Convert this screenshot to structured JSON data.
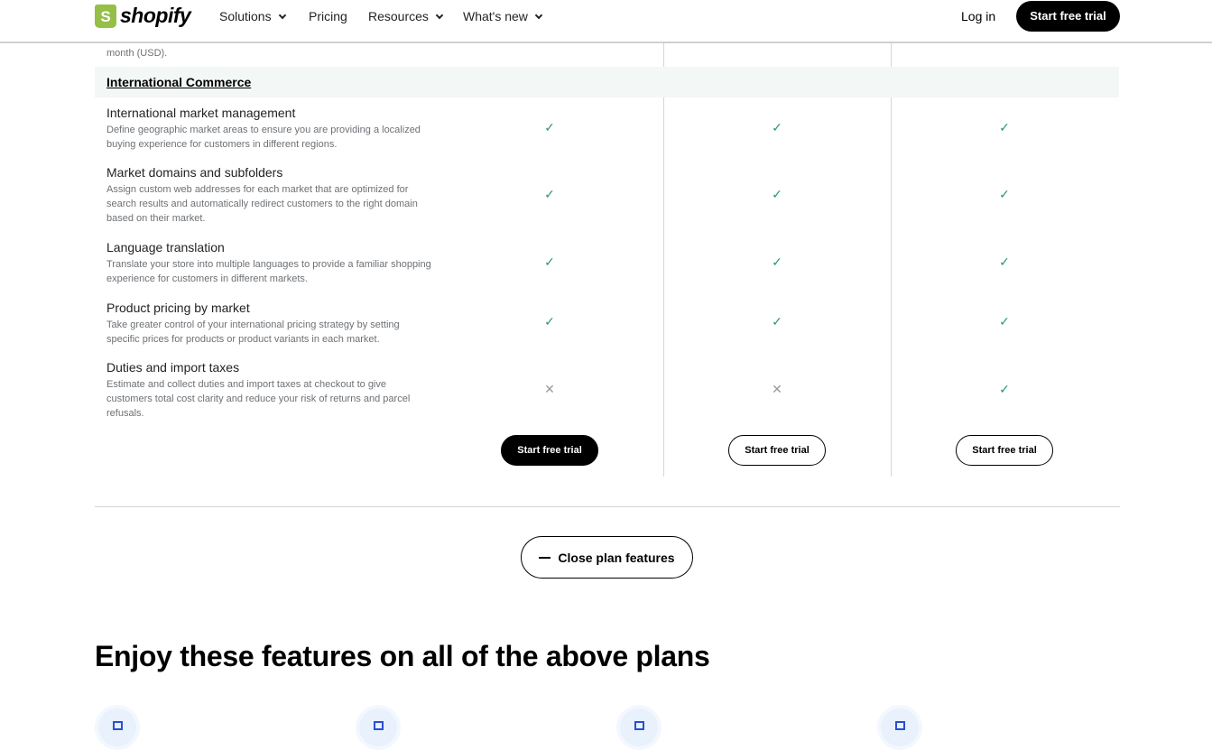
{
  "nav": {
    "logo": "shopify",
    "items": [
      "Solutions",
      "Pricing",
      "Resources",
      "What's new"
    ],
    "login": "Log in",
    "cta": "Start free trial"
  },
  "table": {
    "prev_note": "month (USD).",
    "section": "International Commerce",
    "rows": [
      {
        "title": "International market management",
        "desc": "Define geographic market areas to ensure you are providing a localized buying experience for customers in different regions.",
        "plans": [
          true,
          true,
          true
        ]
      },
      {
        "title": "Market domains and subfolders",
        "desc": "Assign custom web addresses for each market that are optimized for search results and automatically redirect customers to the right domain based on their market.",
        "plans": [
          true,
          true,
          true
        ]
      },
      {
        "title": "Language translation",
        "desc": "Translate your store into multiple languages to provide a familiar shopping experience for customers in different markets.",
        "plans": [
          true,
          true,
          true
        ]
      },
      {
        "title": "Product pricing by market",
        "desc": "Take greater control of your international pricing strategy by setting specific prices for products or product variants in each market.",
        "plans": [
          true,
          true,
          true
        ]
      },
      {
        "title": "Duties and import taxes",
        "desc": "Estimate and collect duties and import taxes at checkout to give customers total cost clarity and reduce your risk of returns and parcel refusals.",
        "plans": [
          false,
          false,
          true
        ]
      }
    ],
    "trial_buttons": [
      "Start free trial",
      "Start free trial",
      "Start free trial"
    ]
  },
  "close_label": "Close plan features",
  "features_heading": "Enjoy these features on all of the above plans",
  "colors": {
    "check": "#2e9a6e",
    "brand": "#95bf47"
  }
}
